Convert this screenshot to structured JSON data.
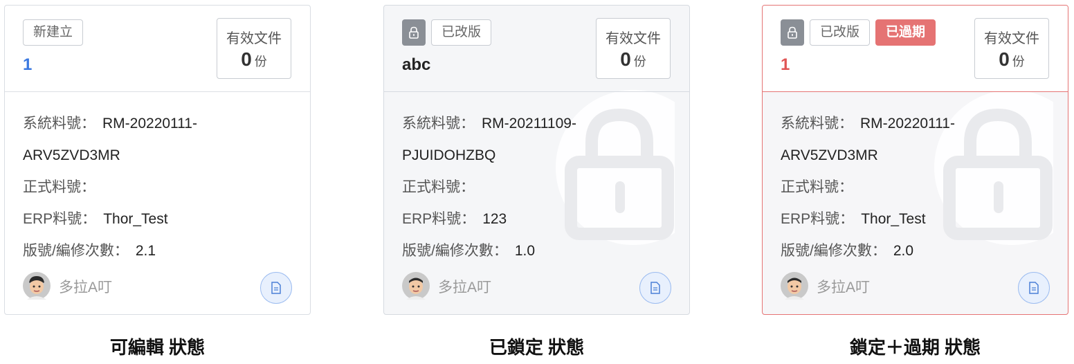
{
  "cards": [
    {
      "tags": [
        "新建立"
      ],
      "name": "1",
      "doc_box": {
        "title": "有效文件",
        "count": "0",
        "unit": "份"
      },
      "fields": {
        "system_label": "系統料號：",
        "system_value": "RM-20220111-",
        "system_value_cont": "ARV5ZVD3MR",
        "official_label": "正式料號：",
        "official_value": "",
        "erp_label": "ERP料號：",
        "erp_value": "Thor_Test",
        "version_label": "版號/編修次數：",
        "version_value": "2.1"
      },
      "user": "多拉A叮"
    },
    {
      "tags": [
        "已改版"
      ],
      "name": "abc",
      "doc_box": {
        "title": "有效文件",
        "count": "0",
        "unit": "份"
      },
      "fields": {
        "system_label": "系統料號：",
        "system_value": "RM-20211109-",
        "system_value_cont": "PJUIDOHZBQ",
        "official_label": "正式料號：",
        "official_value": "",
        "erp_label": "ERP料號：",
        "erp_value": "123",
        "version_label": "版號/編修次數：",
        "version_value": "1.0"
      },
      "user": "多拉A叮"
    },
    {
      "tags": [
        "已改版",
        "已過期"
      ],
      "name": "1",
      "doc_box": {
        "title": "有效文件",
        "count": "0",
        "unit": "份"
      },
      "fields": {
        "system_label": "系統料號：",
        "system_value": "RM-20220111-",
        "system_value_cont": "ARV5ZVD3MR",
        "official_label": "正式料號：",
        "official_value": "",
        "erp_label": "ERP料號：",
        "erp_value": "Thor_Test",
        "version_label": "版號/編修次數：",
        "version_value": "2.0"
      },
      "user": "多拉A叮"
    }
  ],
  "captions": [
    "可編輯 狀態",
    "已鎖定 狀態",
    "鎖定＋過期 狀態"
  ],
  "colors": {
    "name_blue": "#3a78e0",
    "name_red": "#e05555",
    "expired_tag": "#e57373",
    "lock_badge": "#8a8f96",
    "doc_button_bg": "#e8f0fd"
  },
  "icons": [
    "lock-icon",
    "document-icon",
    "avatar-icon",
    "lock-watermark-icon"
  ]
}
